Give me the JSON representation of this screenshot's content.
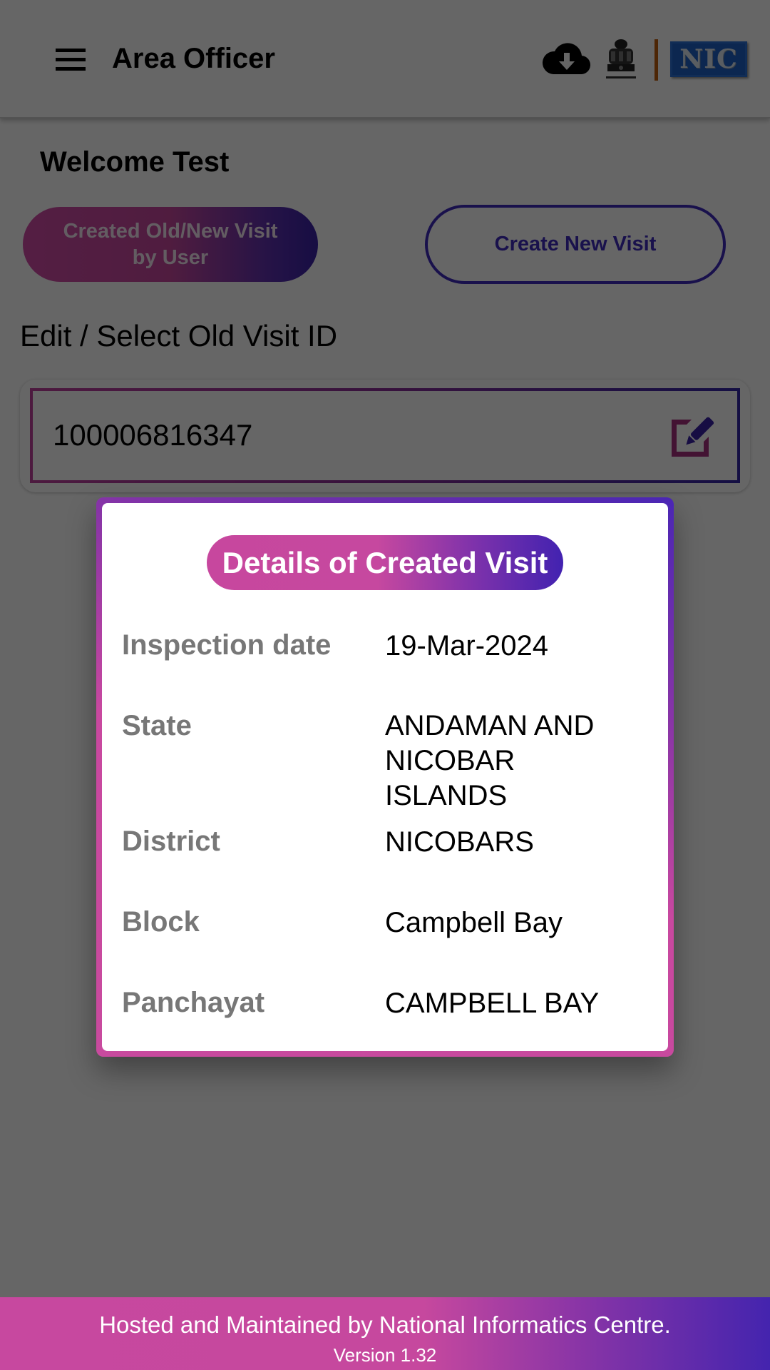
{
  "appbar": {
    "title": "Area Officer",
    "icons": [
      "menu-icon",
      "cloud-download-icon",
      "national-emblem-icon",
      "nic-logo"
    ],
    "nic_logo_text": "NIC"
  },
  "main": {
    "welcome": "Welcome Test",
    "buttons": {
      "created_visits": "Created Old/New Visit by User",
      "create_new_visit": "Create New Visit"
    },
    "section_label": "Edit / Select Old Visit ID",
    "visit_id_field": {
      "value": "100006816347",
      "icon": "edit-icon"
    }
  },
  "dialog": {
    "title": "Details of Created Visit",
    "rows": [
      {
        "label": "Inspection date",
        "value": "19-Mar-2024"
      },
      {
        "label": "State",
        "value": "ANDAMAN AND NICOBAR ISLANDS"
      },
      {
        "label": "District",
        "value": "NICOBARS"
      },
      {
        "label": "Block",
        "value": "Campbell Bay"
      },
      {
        "label": "Panchayat",
        "value": "CAMPBELL BAY"
      }
    ]
  },
  "footer": {
    "line1": "Hosted and Maintained by National Informatics Centre.",
    "line2": "Version 1.32"
  },
  "colors": {
    "accent_pink": "#c7489f",
    "accent_indigo": "#4424ae",
    "label_gray": "#777777",
    "scrim": "rgba(0,0,0,0.6)"
  }
}
